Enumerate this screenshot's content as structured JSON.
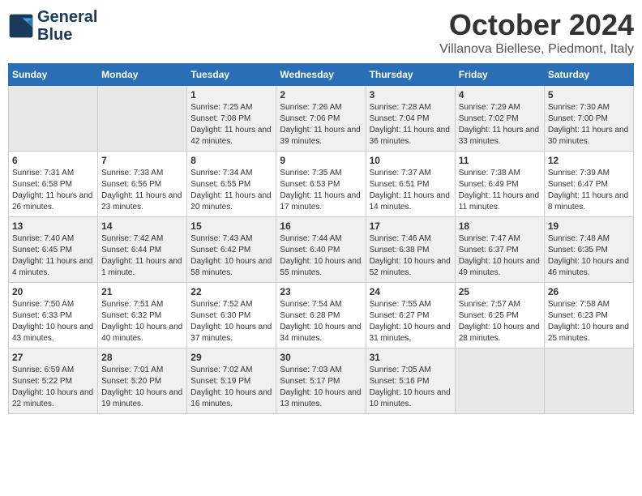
{
  "header": {
    "logo_line1": "General",
    "logo_line2": "Blue",
    "month": "October 2024",
    "location": "Villanova Biellese, Piedmont, Italy"
  },
  "weekdays": [
    "Sunday",
    "Monday",
    "Tuesday",
    "Wednesday",
    "Thursday",
    "Friday",
    "Saturday"
  ],
  "weeks": [
    [
      {
        "day": "",
        "info": ""
      },
      {
        "day": "",
        "info": ""
      },
      {
        "day": "1",
        "info": "Sunrise: 7:25 AM\nSunset: 7:08 PM\nDaylight: 11 hours and 42 minutes."
      },
      {
        "day": "2",
        "info": "Sunrise: 7:26 AM\nSunset: 7:06 PM\nDaylight: 11 hours and 39 minutes."
      },
      {
        "day": "3",
        "info": "Sunrise: 7:28 AM\nSunset: 7:04 PM\nDaylight: 11 hours and 36 minutes."
      },
      {
        "day": "4",
        "info": "Sunrise: 7:29 AM\nSunset: 7:02 PM\nDaylight: 11 hours and 33 minutes."
      },
      {
        "day": "5",
        "info": "Sunrise: 7:30 AM\nSunset: 7:00 PM\nDaylight: 11 hours and 30 minutes."
      }
    ],
    [
      {
        "day": "6",
        "info": "Sunrise: 7:31 AM\nSunset: 6:58 PM\nDaylight: 11 hours and 26 minutes."
      },
      {
        "day": "7",
        "info": "Sunrise: 7:33 AM\nSunset: 6:56 PM\nDaylight: 11 hours and 23 minutes."
      },
      {
        "day": "8",
        "info": "Sunrise: 7:34 AM\nSunset: 6:55 PM\nDaylight: 11 hours and 20 minutes."
      },
      {
        "day": "9",
        "info": "Sunrise: 7:35 AM\nSunset: 6:53 PM\nDaylight: 11 hours and 17 minutes."
      },
      {
        "day": "10",
        "info": "Sunrise: 7:37 AM\nSunset: 6:51 PM\nDaylight: 11 hours and 14 minutes."
      },
      {
        "day": "11",
        "info": "Sunrise: 7:38 AM\nSunset: 6:49 PM\nDaylight: 11 hours and 11 minutes."
      },
      {
        "day": "12",
        "info": "Sunrise: 7:39 AM\nSunset: 6:47 PM\nDaylight: 11 hours and 8 minutes."
      }
    ],
    [
      {
        "day": "13",
        "info": "Sunrise: 7:40 AM\nSunset: 6:45 PM\nDaylight: 11 hours and 4 minutes."
      },
      {
        "day": "14",
        "info": "Sunrise: 7:42 AM\nSunset: 6:44 PM\nDaylight: 11 hours and 1 minute."
      },
      {
        "day": "15",
        "info": "Sunrise: 7:43 AM\nSunset: 6:42 PM\nDaylight: 10 hours and 58 minutes."
      },
      {
        "day": "16",
        "info": "Sunrise: 7:44 AM\nSunset: 6:40 PM\nDaylight: 10 hours and 55 minutes."
      },
      {
        "day": "17",
        "info": "Sunrise: 7:46 AM\nSunset: 6:38 PM\nDaylight: 10 hours and 52 minutes."
      },
      {
        "day": "18",
        "info": "Sunrise: 7:47 AM\nSunset: 6:37 PM\nDaylight: 10 hours and 49 minutes."
      },
      {
        "day": "19",
        "info": "Sunrise: 7:48 AM\nSunset: 6:35 PM\nDaylight: 10 hours and 46 minutes."
      }
    ],
    [
      {
        "day": "20",
        "info": "Sunrise: 7:50 AM\nSunset: 6:33 PM\nDaylight: 10 hours and 43 minutes."
      },
      {
        "day": "21",
        "info": "Sunrise: 7:51 AM\nSunset: 6:32 PM\nDaylight: 10 hours and 40 minutes."
      },
      {
        "day": "22",
        "info": "Sunrise: 7:52 AM\nSunset: 6:30 PM\nDaylight: 10 hours and 37 minutes."
      },
      {
        "day": "23",
        "info": "Sunrise: 7:54 AM\nSunset: 6:28 PM\nDaylight: 10 hours and 34 minutes."
      },
      {
        "day": "24",
        "info": "Sunrise: 7:55 AM\nSunset: 6:27 PM\nDaylight: 10 hours and 31 minutes."
      },
      {
        "day": "25",
        "info": "Sunrise: 7:57 AM\nSunset: 6:25 PM\nDaylight: 10 hours and 28 minutes."
      },
      {
        "day": "26",
        "info": "Sunrise: 7:58 AM\nSunset: 6:23 PM\nDaylight: 10 hours and 25 minutes."
      }
    ],
    [
      {
        "day": "27",
        "info": "Sunrise: 6:59 AM\nSunset: 5:22 PM\nDaylight: 10 hours and 22 minutes."
      },
      {
        "day": "28",
        "info": "Sunrise: 7:01 AM\nSunset: 5:20 PM\nDaylight: 10 hours and 19 minutes."
      },
      {
        "day": "29",
        "info": "Sunrise: 7:02 AM\nSunset: 5:19 PM\nDaylight: 10 hours and 16 minutes."
      },
      {
        "day": "30",
        "info": "Sunrise: 7:03 AM\nSunset: 5:17 PM\nDaylight: 10 hours and 13 minutes."
      },
      {
        "day": "31",
        "info": "Sunrise: 7:05 AM\nSunset: 5:16 PM\nDaylight: 10 hours and 10 minutes."
      },
      {
        "day": "",
        "info": ""
      },
      {
        "day": "",
        "info": ""
      }
    ]
  ]
}
